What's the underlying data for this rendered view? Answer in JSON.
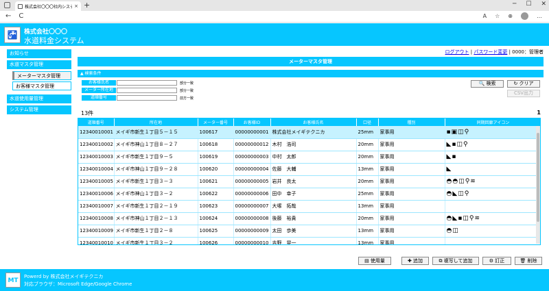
{
  "browser": {
    "tab_title": "株式会社〇〇〇社内システム／メ…",
    "tab_close": "×",
    "new_tab": "+",
    "back": "←",
    "reload": "C",
    "win_min": "─",
    "win_max": "☐",
    "win_close": "✕",
    "read_aloud": "A",
    "favorite": "☆",
    "collections": "⊕",
    "menu": "…"
  },
  "header": {
    "company": "株式会社〇〇〇",
    "system_name": "水道料金システム",
    "logo_glyph": "🚰"
  },
  "toplinks": {
    "logout": "ログアウト",
    "sep": "|",
    "change_password": "パスワード変更",
    "user": "| 0000：管理者"
  },
  "sidebar": {
    "items": [
      {
        "label": "お知らせ"
      },
      {
        "label": "水道マスタ管理"
      },
      {
        "label": "メーターマスタ管理"
      },
      {
        "label": "お客様マスタ管理"
      },
      {
        "label": "水道使用量管理"
      },
      {
        "label": "システム管理"
      }
    ]
  },
  "main": {
    "title": "メーターマスタ管理",
    "search_header": "▲ 検索条件",
    "criteria": [
      {
        "label": "お客様氏名",
        "mode": "部分一致"
      },
      {
        "label": "メーター所在地",
        "mode": "部分一致"
      },
      {
        "label": "道順番号",
        "mode": "前方一致"
      }
    ],
    "search_button": "🔍 検索",
    "clear_button": "↻ クリア",
    "csv_button": "CSV出力",
    "count": "13件",
    "page": "1"
  },
  "table": {
    "headers": [
      "道順番号",
      "所在地",
      "メーター番号",
      "お客様ID",
      "お客様氏名",
      "口径",
      "種別",
      "同期回廊アイコン"
    ],
    "rows": [
      {
        "c1": "12340010001",
        "c2": "メイギ市新生１丁目５－１５",
        "c3": "100617",
        "c4": "00000000001",
        "c5": "株式会社メイギテクニカ",
        "c6": "25mm",
        "c7": "家事用",
        "c8": "▪▣◫⚲"
      },
      {
        "c1": "12340010002",
        "c2": "メイギ市神山１丁目８－２７",
        "c3": "100618",
        "c4": "00000000012",
        "c5": "木村　浩司",
        "c6": "20mm",
        "c7": "家事用",
        "c8": "◣▪◫⚲"
      },
      {
        "c1": "12340010003",
        "c2": "メイギ市新生１丁目９－５",
        "c3": "100619",
        "c4": "00000000003",
        "c5": "中村　太郎",
        "c6": "20mm",
        "c7": "家事用",
        "c8": "◣▪"
      },
      {
        "c1": "12340010004",
        "c2": "メイギ市神山１丁目９－２８",
        "c3": "100620",
        "c4": "00000000004",
        "c5": "佐藤　大輔",
        "c6": "13mm",
        "c7": "家事用",
        "c8": "◣"
      },
      {
        "c1": "12340010005",
        "c2": "メイギ市新生１丁目３－３",
        "c3": "100621",
        "c4": "00000000005",
        "c5": "岩井　良太",
        "c6": "20mm",
        "c7": "家事用",
        "c8": "◓◓◫⚲≋"
      },
      {
        "c1": "12340010006",
        "c2": "メイギ市神山１丁目３－２",
        "c3": "100622",
        "c4": "00000000006",
        "c5": "田中　幸子",
        "c6": "25mm",
        "c7": "家事用",
        "c8": "◓◣◫⚲"
      },
      {
        "c1": "12340010007",
        "c2": "メイギ市新生１丁目２－１９",
        "c3": "100623",
        "c4": "00000000007",
        "c5": "大塚　拓哉",
        "c6": "13mm",
        "c7": "家事用",
        "c8": ""
      },
      {
        "c1": "12340010008",
        "c2": "メイギ市神山１丁目２－１３",
        "c3": "100624",
        "c4": "00000000008",
        "c5": "後藤　裕貴",
        "c6": "20mm",
        "c7": "家事用",
        "c8": "◓◣▪◫⚲≋"
      },
      {
        "c1": "12340010009",
        "c2": "メイギ市新生１丁目２－８",
        "c3": "100625",
        "c4": "00000000009",
        "c5": "太田　歩美",
        "c6": "13mm",
        "c7": "家事用",
        "c8": "◓◫"
      },
      {
        "c1": "12340010010",
        "c2": "メイギ市新生１丁目３－２",
        "c3": "100626",
        "c4": "00000000010",
        "c5": "吉野　晃一",
        "c6": "13mm",
        "c7": "家事用",
        "c8": ""
      }
    ]
  },
  "actions": {
    "usage": "▤ 使用量",
    "add": "✚ 追加",
    "copy_add": "⧉ 複写して追加",
    "edit": "⚙ 訂正",
    "delete": "🗑 削除"
  },
  "footer": {
    "logo": "MT",
    "powered": "Powerd by 株式会社メイギテクニカ",
    "browser": "対応ブラウザ：Microsoft Edge/Google Chrome"
  }
}
